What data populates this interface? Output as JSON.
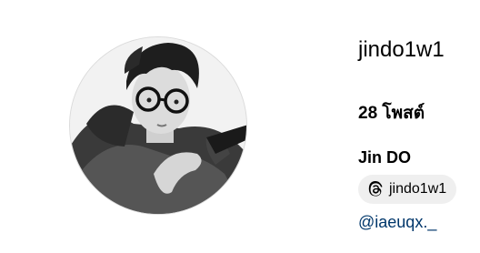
{
  "profile": {
    "username": "jindo1w1",
    "posts_count": "28",
    "posts_label": "โพสต์",
    "full_name": "Jin DO",
    "threads_handle": "jindo1w1",
    "mention_link": "@iaeuqx._"
  },
  "icons": {
    "threads": "threads-icon"
  },
  "colors": {
    "link": "#00376b",
    "badge_bg": "#efefef",
    "text": "#000000"
  }
}
